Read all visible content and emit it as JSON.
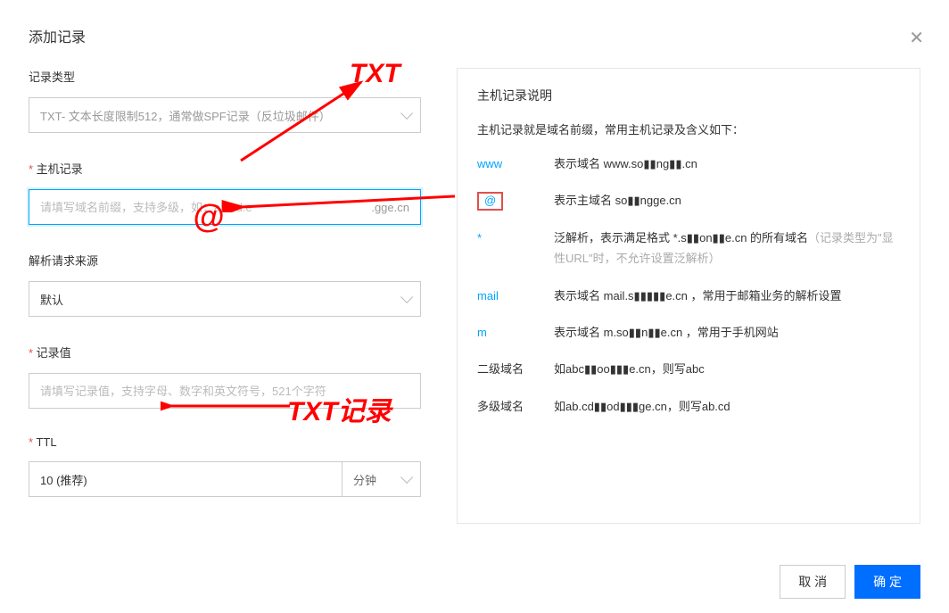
{
  "title": "添加记录",
  "form": {
    "recordType": {
      "label": "记录类型",
      "value": "TXT- 文本长度限制512，通常做SPF记录（反垃圾邮件）"
    },
    "host": {
      "label": "主机记录",
      "placeholder": "请填写域名前缀，支持多级，如：ab.cd.e",
      "suffix": ".gge.cn"
    },
    "line": {
      "label": "解析请求来源",
      "value": "默认"
    },
    "value": {
      "label": "记录值",
      "placeholder": "请填写记录值，支持字母、数字和英文符号，521个字符"
    },
    "ttl": {
      "label": "TTL",
      "value": "10 (推荐)",
      "unit": "分钟"
    }
  },
  "help": {
    "title": "主机记录说明",
    "hint": "主机记录就是域名前缀，常用主机记录及含义如下：",
    "rows": [
      {
        "k": "www",
        "v": "表示域名 www.so▮▮ng▮▮.cn"
      },
      {
        "k": "@",
        "v": "表示主域名 so▮▮ngge.cn",
        "boxed": true
      },
      {
        "k": "*",
        "v": "泛解析，表示满足格式 *.s▮▮on▮▮e.cn 的所有域名",
        "extra": "（记录类型为\"显性URL\"时，不允许设置泛解析）"
      },
      {
        "k": "mail",
        "v": "表示域名 mail.s▮▮▮▮▮e.cn ，常用于邮箱业务的解析设置"
      },
      {
        "k": "m",
        "v": "表示域名 m.so▮▮n▮▮e.cn ，常用于手机网站"
      },
      {
        "k": "二级域名",
        "v": "如abc▮▮oo▮▮▮e.cn，则写abc",
        "dark": true
      },
      {
        "k": "多级域名",
        "v": "如ab.cd▮▮od▮▮▮ge.cn，则写ab.cd",
        "dark": true
      }
    ]
  },
  "buttons": {
    "cancel": "取 消",
    "ok": "确 定"
  },
  "anno": {
    "txt": "TXT",
    "at": "@",
    "txtrec": "TXT记录"
  }
}
